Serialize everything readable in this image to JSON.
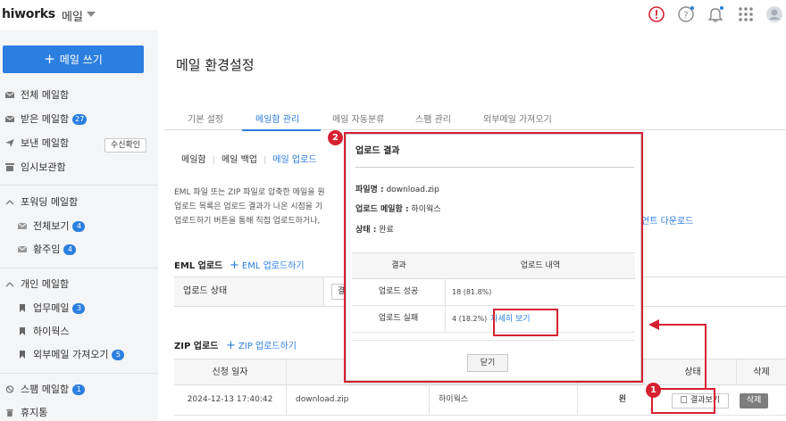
{
  "header": {
    "logo": "hiworks",
    "app_name": "메일"
  },
  "sidebar": {
    "compose_label": "메일 쓰기",
    "items": [
      {
        "label": "전체 메일함",
        "icon": "envelope-icon"
      },
      {
        "label": "받은 메일함",
        "badge": "27",
        "icon": "inbox-icon"
      },
      {
        "label": "보낸 메일함",
        "icon": "send-icon"
      },
      {
        "label": "임시보관함",
        "icon": "drafts-icon"
      }
    ],
    "receipt_check_label": "수신확인",
    "forwarding": {
      "title": "포워딩 메일함",
      "items": [
        {
          "label": "전체보기",
          "badge": "4"
        },
        {
          "label": "황주임",
          "badge": "4"
        }
      ]
    },
    "personal": {
      "title": "개인 메일함",
      "items": [
        {
          "label": "업무메일",
          "badge": "3"
        },
        {
          "label": "하이웍스",
          "badge": ""
        },
        {
          "label": "외부메일 가져오기",
          "badge": "5"
        }
      ]
    },
    "spam": {
      "label": "스팸 메일함",
      "badge": "1"
    },
    "trash": {
      "label": "휴지통"
    }
  },
  "main": {
    "title": "메일 환경설정",
    "tabs": [
      "기본 설정",
      "메일함 관리",
      "메일 자동분류",
      "스팸 관리",
      "외부메일 가져오기"
    ],
    "active_tab": "메일함 관리",
    "subtabs": [
      "메일함",
      "메일 백업",
      "메일 업로드"
    ],
    "desc_lines": [
      "EML 파일 또는 ZIP 파일로 압축한 메일을 원",
      "업로드 목록은 업로드 결과가 나온 시점을 기",
      "업로드하기 버튼을 통해 직접 업로드하거나,"
    ],
    "desc_link": "언트 다운로드",
    "eml_section": {
      "title": "EML 업로드",
      "link": "EML 업로드하기",
      "status_label": "업로드 상태",
      "status_value": "결"
    },
    "zip_section": {
      "title": "ZIP 업로드",
      "link": "ZIP 업로드하기",
      "headers": {
        "date": "신청 일자",
        "status": "상태",
        "delete": "삭제"
      },
      "row": {
        "date": "2024-12-13 17:40:42",
        "file": "download.zip",
        "mailbox": "하이웍스",
        "state": "왼",
        "result_button": "결과보기",
        "delete_button": "삭제"
      }
    }
  },
  "modal": {
    "title": "업로드 결과",
    "filename_label": "파일명 :",
    "filename": "download.zip",
    "mailbox_label": "업로드 메일함 :",
    "mailbox": "하이웍스",
    "status_label": "상태 :",
    "status": "완료",
    "headers": {
      "result": "결과",
      "detail": "업로드 내역"
    },
    "rows": [
      {
        "result": "업로드 성공",
        "detail": "18 (81.8%)"
      },
      {
        "result": "업로드 실패",
        "detail": "4 (18.2%)",
        "link": "자세히 보기"
      }
    ],
    "close_label": "닫기"
  },
  "annotations": {
    "step1": "1",
    "step2": "2"
  },
  "colors": {
    "accent": "#2b7fe0",
    "annotation": "#d62031",
    "sidebar_bg": "#f4f5f7"
  }
}
